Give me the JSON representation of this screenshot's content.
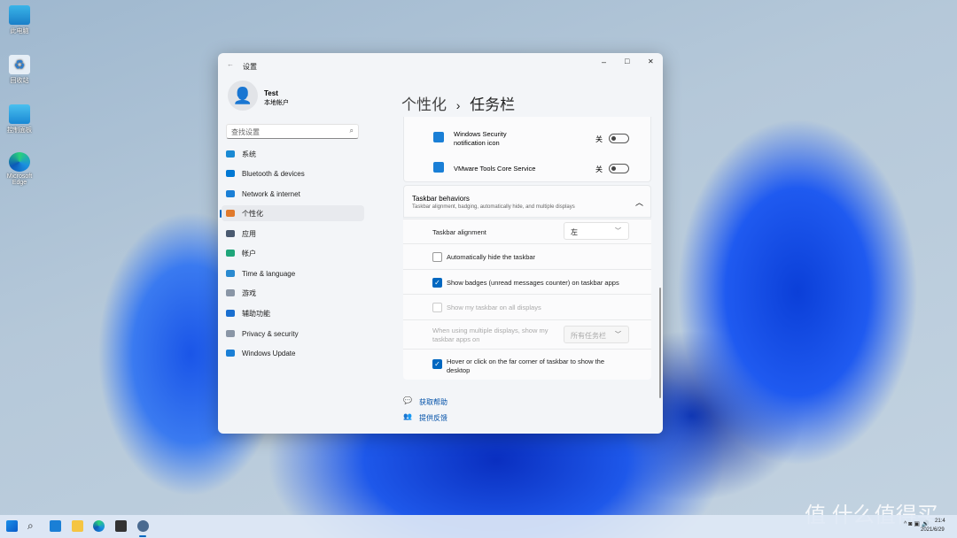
{
  "desktop": {
    "icons": [
      "此电脑",
      "回收站",
      "控制面板",
      "Microsoft Edge"
    ]
  },
  "window": {
    "title": "设置",
    "controls": {
      "minimize": "–",
      "maximize": "□",
      "close": "✕"
    }
  },
  "profile": {
    "name": "Test",
    "type": "本地帐户"
  },
  "search": {
    "placeholder": "查找设置"
  },
  "nav": [
    {
      "label": "系统",
      "color": "#1a8ad4"
    },
    {
      "label": "Bluetooth & devices",
      "color": "#0078d4"
    },
    {
      "label": "Network & internet",
      "color": "#1a7fd6"
    },
    {
      "label": "个性化",
      "color": "#e07a2c",
      "selected": true
    },
    {
      "label": "应用",
      "color": "#4a5a70"
    },
    {
      "label": "帐户",
      "color": "#1fa67a"
    },
    {
      "label": "Time & language",
      "color": "#2a8ad0"
    },
    {
      "label": "游戏",
      "color": "#8a96a6"
    },
    {
      "label": "辅助功能",
      "color": "#1a6fd0"
    },
    {
      "label": "Privacy & security",
      "color": "#8a96a6"
    },
    {
      "label": "Windows Update",
      "color": "#1a7fd6"
    }
  ],
  "breadcrumb": {
    "parent": "个性化",
    "separator": "›",
    "current": "任务栏"
  },
  "tray_items": [
    {
      "label_line1": "Windows Security",
      "label_line2": "notification icon",
      "state": "关"
    },
    {
      "label_line1": "VMware Tools Core Service",
      "label_line2": "",
      "state": "关"
    }
  ],
  "behaviors": {
    "title": "Taskbar behaviors",
    "subtitle": "Taskbar alignment, badging, automatically hide, and multiple displays",
    "alignment_label": "Taskbar alignment",
    "alignment_value": "左",
    "auto_hide": "Automatically hide the taskbar",
    "badges": "Show badges (unread messages counter) on taskbar apps",
    "all_displays": "Show my taskbar on all displays",
    "multi_label_1": "When using multiple displays, show my",
    "multi_label_2": "taskbar apps on",
    "multi_value": "所有任务栏",
    "far_corner_1": "Hover or click on the far corner of taskbar to show the",
    "far_corner_2": "desktop"
  },
  "links": {
    "help": "获取帮助",
    "feedback": "提供反馈"
  },
  "clock": {
    "time": "21:4",
    "date": "2021/6/29"
  },
  "watermark": "值 什么值得买"
}
